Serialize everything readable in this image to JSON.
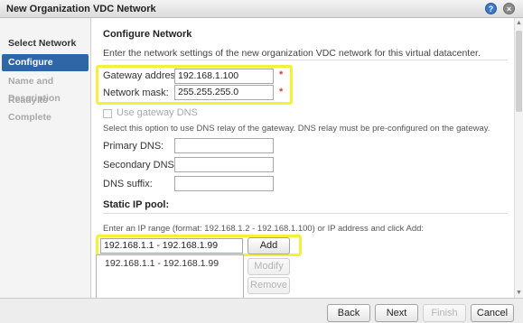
{
  "window": {
    "title": "New Organization VDC Network",
    "help_icon": "?",
    "close_icon": "×"
  },
  "sidebar": {
    "items": [
      {
        "label": "Select Network Type",
        "state": "done"
      },
      {
        "label": "Configure Network",
        "state": "active"
      },
      {
        "label": "Name and Description",
        "state": "disabled"
      },
      {
        "label": "Ready to Complete",
        "state": "disabled"
      }
    ]
  },
  "main": {
    "section_title": "Configure Network",
    "description": "Enter the network settings of the new organization VDC network for this virtual datacenter.",
    "gateway": {
      "label": "Gateway address:",
      "value": "192.168.1.100",
      "required": "*"
    },
    "netmask": {
      "label": "Network mask:",
      "value": "255.255.255.0",
      "required": "*"
    },
    "use_gateway_dns": {
      "label": "Use gateway DNS",
      "checked": false
    },
    "dns_note": "Select this option to use DNS relay of the gateway. DNS relay must be pre-configured on the gateway.",
    "primary_dns": {
      "label": "Primary DNS:",
      "value": ""
    },
    "secondary_dns": {
      "label": "Secondary DNS:",
      "value": ""
    },
    "dns_suffix": {
      "label": "DNS suffix:",
      "value": ""
    },
    "static_pool": {
      "title": "Static IP pool:",
      "instructions": "Enter an IP range (format: 192.168.1.2 - 192.168.1.100) or IP address and click Add:",
      "input_value": "192.168.1.1 - 192.168.1.99",
      "add_label": "Add",
      "modify_label": "Modify",
      "remove_label": "Remove",
      "items": [
        "192.168.1.1 - 192.168.1.99"
      ]
    }
  },
  "footer": {
    "back": "Back",
    "next": "Next",
    "finish": "Finish",
    "cancel": "Cancel"
  },
  "colors": {
    "accent": "#2f66a8",
    "highlight": "#f4f13c",
    "required": "#e13a3a"
  }
}
